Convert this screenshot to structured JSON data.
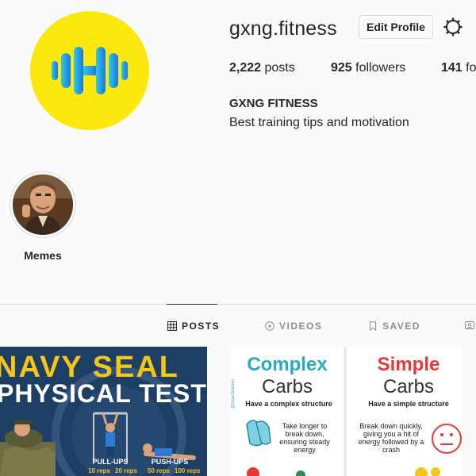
{
  "profile": {
    "username": "gxng.fitness",
    "edit_label": "Edit Profile",
    "full_name": "GXNG FITNESS",
    "bio": "Best training tips and motivation",
    "logo_color": "#fce80c",
    "logo_gradient": [
      "#2ecbe0",
      "#1a73e8"
    ]
  },
  "stats": {
    "posts_count": "2,222",
    "posts_label": "posts",
    "followers_count": "925",
    "followers_label": "followers",
    "following_count": "141",
    "following_label": "fo"
  },
  "highlights": [
    {
      "label": "Memes"
    }
  ],
  "tabs": [
    {
      "label": "POSTS",
      "icon": "grid-icon",
      "active": true
    },
    {
      "label": "VIDEOS",
      "icon": "play-icon",
      "active": false
    },
    {
      "label": "SAVED",
      "icon": "bookmark-icon",
      "active": false
    },
    {
      "label": "",
      "icon": "tagged-icon",
      "active": false
    }
  ],
  "posts": [
    {
      "title_line1": "NAVY SEAL",
      "title_line2": "PHYSICAL TEST",
      "exercises": [
        {
          "name": "PULL-UPS",
          "reps": "10 reps",
          "reps2": "20 reps"
        },
        {
          "name": "PUSH-UPS",
          "reps": "50 reps",
          "reps2": "100 reps"
        }
      ]
    },
    {
      "left": {
        "title1": "Complex",
        "title2": "Carbs",
        "subtitle": "Have a complex structure",
        "desc": [
          "Take longer to",
          "break down,",
          "ensuring steady",
          "energy"
        ],
        "watermark": "@SuperNutrition"
      },
      "right": {
        "title1": "Simple",
        "title2": "Carbs",
        "subtitle": "Have a simple structure",
        "desc": [
          "Break down quickly,",
          "giving you a hit of",
          "energy followed by a",
          "crash"
        ]
      }
    }
  ]
}
